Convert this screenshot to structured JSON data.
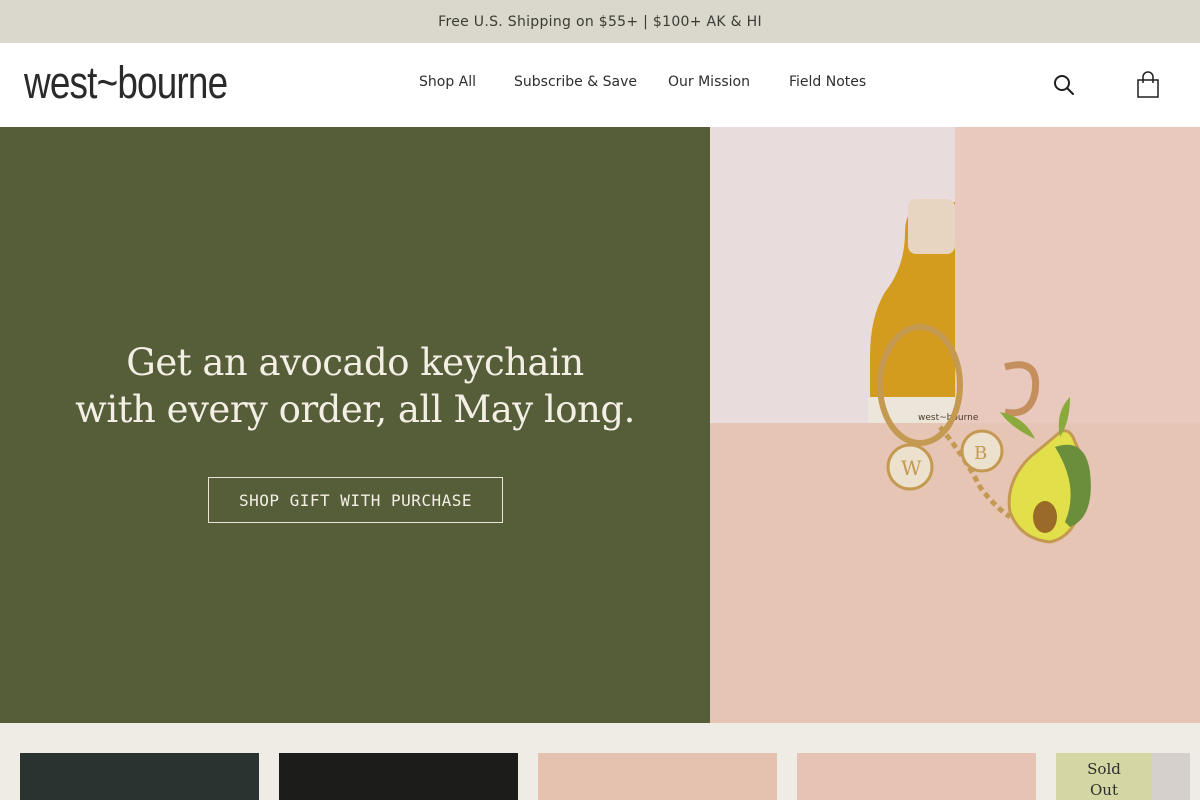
{
  "announcement": "Free U.S. Shipping on $55+ | $100+ AK & HI",
  "logo": "west~bourne",
  "nav": [
    {
      "label": "Shop All"
    },
    {
      "label": "Subscribe & Save"
    },
    {
      "label": "Our Mission"
    },
    {
      "label": "Field Notes"
    }
  ],
  "icons": {
    "search": "search-icon",
    "cart": "shopping-bag-icon"
  },
  "hero": {
    "heading_line1": "Get an avocado keychain",
    "heading_line2": "with every order, all May long.",
    "cta_label": "SHOP GIFT WITH PURCHASE",
    "bottle_label": "west~bourne",
    "charm_letters": [
      "W",
      "B"
    ]
  },
  "products": {
    "badge_line1": "Sold",
    "badge_line2": "Out"
  },
  "colors": {
    "announcement_bg": "#dad8cd",
    "hero_green": "#555d39",
    "hero_pink": "#e6c5b5",
    "page_bg": "#efebe5",
    "sold_out_badge": "#d4d7a3"
  }
}
